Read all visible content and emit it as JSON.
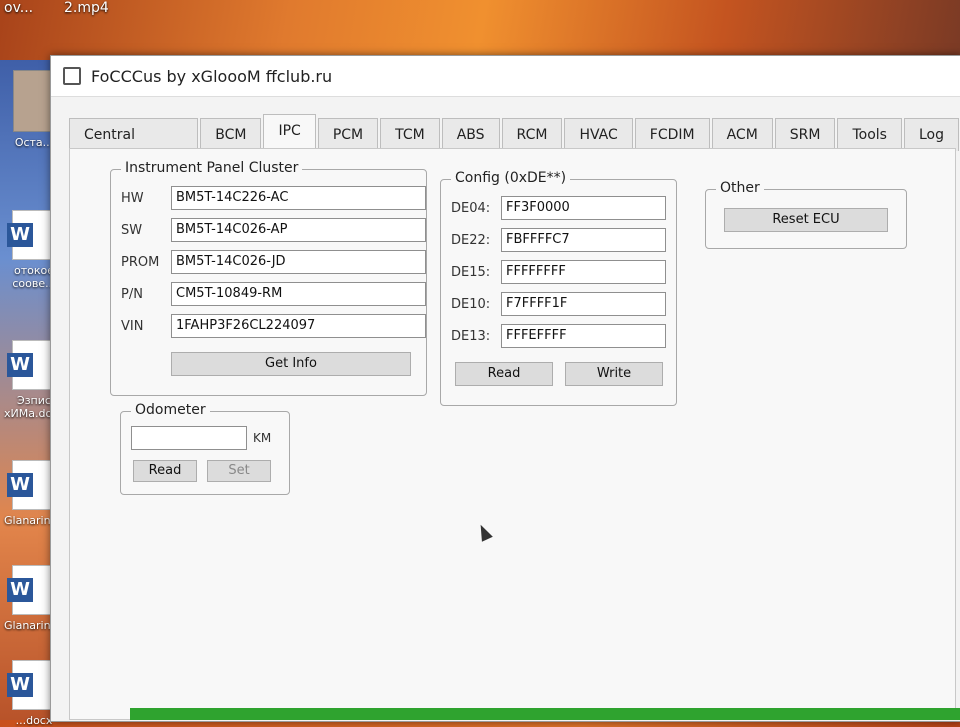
{
  "desktop": {
    "top_files": [
      "ov...",
      "2.mp4"
    ],
    "icons": [
      {
        "label": "Оста...",
        "type": "avatar"
      },
      {
        "label": "отокое\nсоове...",
        "type": "word"
      },
      {
        "label": "Эзпис\nхИМа.docx",
        "type": "word"
      },
      {
        "label": "Glanarinador",
        "type": "word"
      },
      {
        "label": "Glanarinad...",
        "type": "word"
      },
      {
        "label": "...docx",
        "type": "word"
      }
    ]
  },
  "window": {
    "title": "FoCCCus by xGloooM ffclub.ru"
  },
  "tabs": [
    {
      "label": "Central Config",
      "active": false
    },
    {
      "label": "BCM",
      "active": false
    },
    {
      "label": "IPC",
      "active": true
    },
    {
      "label": "PCM",
      "active": false
    },
    {
      "label": "TCM",
      "active": false
    },
    {
      "label": "ABS",
      "active": false
    },
    {
      "label": "RCM",
      "active": false
    },
    {
      "label": "HVAC",
      "active": false
    },
    {
      "label": "FCDIM",
      "active": false
    },
    {
      "label": "ACM",
      "active": false
    },
    {
      "label": "SRM",
      "active": false
    },
    {
      "label": "Tools",
      "active": false
    },
    {
      "label": "Log",
      "active": false
    }
  ],
  "ipc": {
    "title": "Instrument Panel Cluster",
    "fields": [
      {
        "label": "HW",
        "value": "BM5T-14C226-AC"
      },
      {
        "label": "SW",
        "value": "BM5T-14C026-AP"
      },
      {
        "label": "PROM",
        "value": "BM5T-14C026-JD"
      },
      {
        "label": "P/N",
        "value": "CM5T-10849-RM"
      },
      {
        "label": "VIN",
        "value": "1FAHP3F26CL224097"
      }
    ],
    "get_info_label": "Get Info"
  },
  "config": {
    "title": "Config (0xDE**)",
    "fields": [
      {
        "label": "DE04:",
        "value": "FF3F0000"
      },
      {
        "label": "DE22:",
        "value": "FBFFFFC7"
      },
      {
        "label": "DE15:",
        "value": "FFFFFFFF"
      },
      {
        "label": "DE10:",
        "value": "F7FFFF1F"
      },
      {
        "label": "DE13:",
        "value": "FFFEFFFF"
      }
    ],
    "read_label": "Read",
    "write_label": "Write"
  },
  "other": {
    "title": "Other",
    "reset_label": "Reset ECU"
  },
  "odometer": {
    "title": "Odometer",
    "value": "",
    "unit": "KM",
    "read_label": "Read",
    "set_label": "Set"
  }
}
